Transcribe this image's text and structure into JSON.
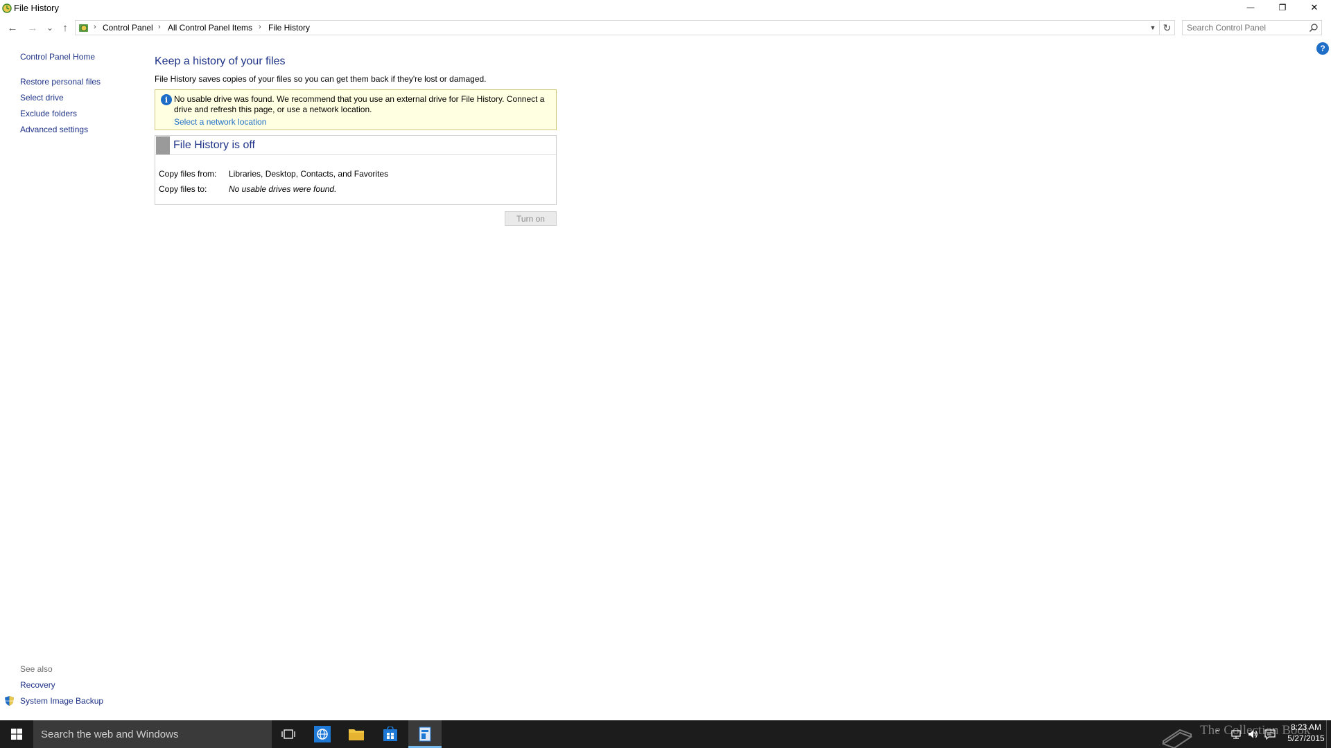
{
  "window": {
    "title": "File History",
    "minimize_glyph": "—",
    "maximize_glyph": "❐",
    "close_glyph": "✕"
  },
  "nav": {
    "back_glyph": "←",
    "forward_glyph": "→",
    "recent_glyph": "⌄",
    "up_glyph": "↑",
    "breadcrumbs": [
      "Control Panel",
      "All Control Panel Items",
      "File History"
    ],
    "separator": "›",
    "refresh_glyph": "↻",
    "dropdown_glyph": "▼"
  },
  "search": {
    "placeholder": "Search Control Panel"
  },
  "help": {
    "glyph": "?"
  },
  "left_pane": {
    "home": "Control Panel Home",
    "links": [
      "Restore personal files",
      "Select drive",
      "Exclude folders",
      "Advanced settings"
    ],
    "see_also_label": "See also",
    "see_also_links": [
      "Recovery",
      "System Image Backup"
    ]
  },
  "main": {
    "title": "Keep a history of your files",
    "description": "File History saves copies of your files so you can get them back if they're lost or damaged.",
    "info": {
      "glyph": "i",
      "text": "No usable drive was found. We recommend that you use an external drive for File History. Connect a drive and refresh this page, or use a network location.",
      "link": "Select a network location"
    },
    "status": {
      "title": "File History is off",
      "copy_from_label": "Copy files from:",
      "copy_from_value": "Libraries, Desktop, Contacts, and Favorites",
      "copy_to_label": "Copy files to:",
      "copy_to_value": "No usable drives were found."
    },
    "turn_on_label": "Turn on"
  },
  "taskbar": {
    "search_text": "Search the web and Windows",
    "watermark": "The Collection Book",
    "time": "8:23 AM",
    "date": "5/27/2015"
  },
  "colors": {
    "link_dark": "#1e3287",
    "link_blue": "#1e6ec8",
    "info_bg": "#ffffe1",
    "taskbar_bg": "#1c1c1c",
    "accent": "#76b9ed"
  }
}
